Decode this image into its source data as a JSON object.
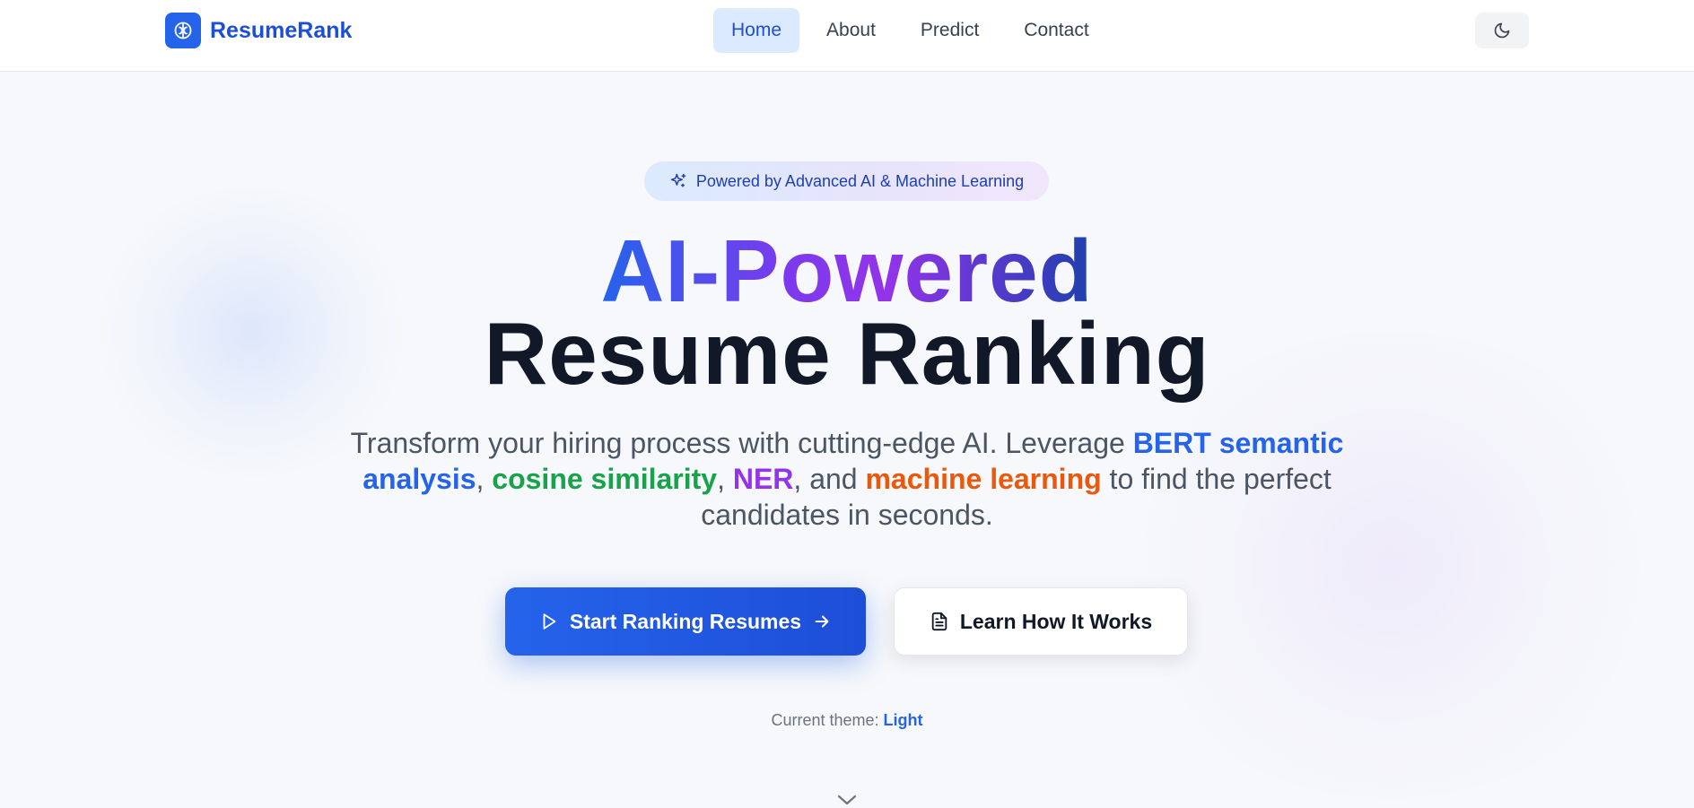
{
  "nav": {
    "brand": "ResumeRank",
    "links": [
      {
        "label": "Home",
        "active": true
      },
      {
        "label": "About",
        "active": false
      },
      {
        "label": "Predict",
        "active": false
      },
      {
        "label": "Contact",
        "active": false
      }
    ],
    "theme_toggle_icon": "moon-icon"
  },
  "hero": {
    "badge": "Powered by Advanced AI & Machine Learning",
    "title_line1": "AI-Powered",
    "title_line2": "Resume Ranking",
    "subtitle": {
      "part1": "Transform your hiring process with cutting-edge AI. Leverage ",
      "hl1": "BERT semantic analysis",
      "sep1": ", ",
      "hl2": "cosine similarity",
      "sep2": ", ",
      "hl3": "NER",
      "sep3": ", and ",
      "hl4": "machine learning",
      "part2": " to find the perfect candidates in seconds."
    },
    "primary_button": "Start Ranking Resumes",
    "secondary_button": "Learn How It Works",
    "theme_label": "Current theme: ",
    "theme_value": "Light"
  },
  "colors": {
    "accent": "#2563eb",
    "green": "#16a34a",
    "purple": "#9333ea",
    "orange": "#ea580c"
  }
}
